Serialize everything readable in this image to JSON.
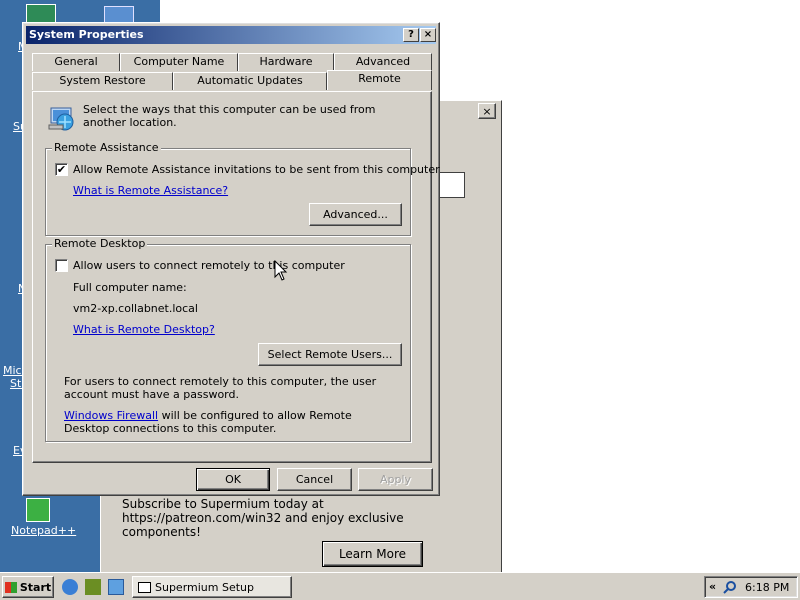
{
  "desktop": {
    "labels": [
      "M",
      "Su",
      "N",
      "Micr",
      "Str",
      "Ev",
      "Notepad++"
    ]
  },
  "background_window": {
    "close_label": "×",
    "body_text": "Subscribe to Supermium today at https://patreon.com/win32 and enjoy exclusive components!",
    "learn_more_label": "Learn More"
  },
  "dialog": {
    "title": "System Properties",
    "help_btn": "?",
    "close_btn": "×",
    "tabs_row1": [
      "General",
      "Computer Name",
      "Hardware",
      "Advanced"
    ],
    "tabs_row2": [
      "System Restore",
      "Automatic Updates",
      "Remote"
    ],
    "active_tab": "Remote",
    "intro_text": "Select the ways that this computer can be used from another location.",
    "remote_assistance": {
      "title": "Remote Assistance",
      "checkbox_label": "Allow Remote Assistance invitations to be sent from this computer",
      "checked": true,
      "check_mark": "✔",
      "link": "What is Remote Assistance?",
      "advanced_btn": "Advanced..."
    },
    "remote_desktop": {
      "title": "Remote Desktop",
      "checkbox_label": "Allow users to connect remotely to this computer",
      "checked": false,
      "full_name_label": "Full computer name:",
      "full_name_value": "vm2-xp.collabnet.local",
      "link": "What is Remote Desktop?",
      "select_users_btn": "Select Remote Users...",
      "password_note": "For users to connect remotely to this computer, the user account must have a password.",
      "firewall_link": "Windows Firewall",
      "firewall_note_rest": " will be configured to allow Remote Desktop connections to this computer."
    },
    "ok_btn": "OK",
    "cancel_btn": "Cancel",
    "apply_btn": "Apply"
  },
  "taskbar": {
    "start_label": "Start",
    "task_item": "Supermium Setup",
    "tray_chevron": "«",
    "clock": "6:18 PM"
  }
}
